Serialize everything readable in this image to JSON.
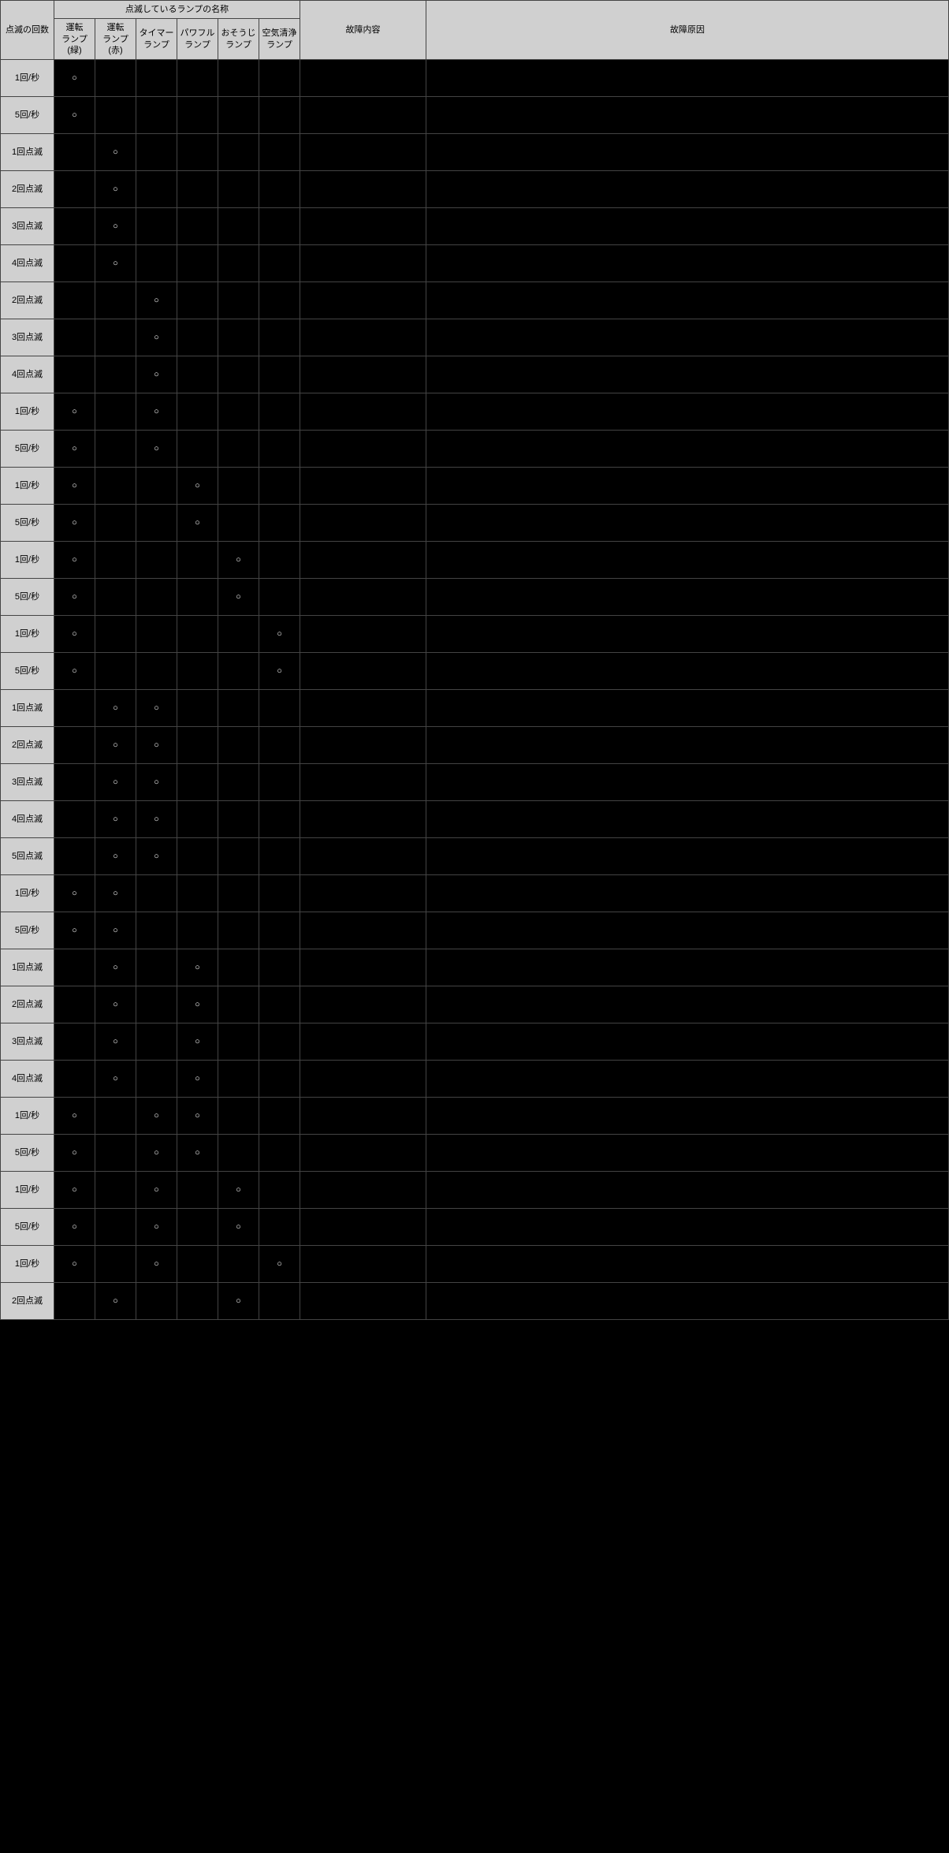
{
  "headers": {
    "count": "点滅の回数",
    "lamp_group": "点滅しているランプの名称",
    "lamps": [
      "運転\nランプ(緑)",
      "運転\nランプ(赤)",
      "タイマー\nランプ",
      "パワフル\nランプ",
      "おそうじ\nランプ",
      "空気清浄\nランプ"
    ],
    "content": "故障内容",
    "cause": "故障原因"
  },
  "rows": [
    {
      "count": "1回/秒",
      "lamps": [
        "○",
        "",
        "",
        "",
        "",
        ""
      ],
      "content": "",
      "cause": ""
    },
    {
      "count": "5回/秒",
      "lamps": [
        "○",
        "",
        "",
        "",
        "",
        ""
      ],
      "content": "",
      "cause": ""
    },
    {
      "count": "1回点滅",
      "lamps": [
        "",
        "○",
        "",
        "",
        "",
        ""
      ],
      "content": "",
      "cause": ""
    },
    {
      "count": "2回点滅",
      "lamps": [
        "",
        "○",
        "",
        "",
        "",
        ""
      ],
      "content": "",
      "cause": ""
    },
    {
      "count": "3回点滅",
      "lamps": [
        "",
        "○",
        "",
        "",
        "",
        ""
      ],
      "content": "",
      "cause": ""
    },
    {
      "count": "4回点滅",
      "lamps": [
        "",
        "○",
        "",
        "",
        "",
        ""
      ],
      "content": "",
      "cause": ""
    },
    {
      "count": "2回点滅",
      "lamps": [
        "",
        "",
        "○",
        "",
        "",
        ""
      ],
      "content": "",
      "cause": ""
    },
    {
      "count": "3回点滅",
      "lamps": [
        "",
        "",
        "○",
        "",
        "",
        ""
      ],
      "content": "",
      "cause": ""
    },
    {
      "count": "4回点滅",
      "lamps": [
        "",
        "",
        "○",
        "",
        "",
        ""
      ],
      "content": "",
      "cause": ""
    },
    {
      "count": "1回/秒",
      "lamps": [
        "○",
        "",
        "○",
        "",
        "",
        ""
      ],
      "content": "",
      "cause": ""
    },
    {
      "count": "5回/秒",
      "lamps": [
        "○",
        "",
        "○",
        "",
        "",
        ""
      ],
      "content": "",
      "cause": ""
    },
    {
      "count": "1回/秒",
      "lamps": [
        "○",
        "",
        "",
        "○",
        "",
        ""
      ],
      "content": "",
      "cause": ""
    },
    {
      "count": "5回/秒",
      "lamps": [
        "○",
        "",
        "",
        "○",
        "",
        ""
      ],
      "content": "",
      "cause": ""
    },
    {
      "count": "1回/秒",
      "lamps": [
        "○",
        "",
        "",
        "",
        "○",
        ""
      ],
      "content": "",
      "cause": ""
    },
    {
      "count": "5回/秒",
      "lamps": [
        "○",
        "",
        "",
        "",
        "○",
        ""
      ],
      "content": "",
      "cause": ""
    },
    {
      "count": "1回/秒",
      "lamps": [
        "○",
        "",
        "",
        "",
        "",
        "○"
      ],
      "content": "",
      "cause": ""
    },
    {
      "count": "5回/秒",
      "lamps": [
        "○",
        "",
        "",
        "",
        "",
        "○"
      ],
      "content": "",
      "cause": ""
    },
    {
      "count": "1回点滅",
      "lamps": [
        "",
        "○",
        "○",
        "",
        "",
        ""
      ],
      "content": "",
      "cause": ""
    },
    {
      "count": "2回点滅",
      "lamps": [
        "",
        "○",
        "○",
        "",
        "",
        ""
      ],
      "content": "",
      "cause": ""
    },
    {
      "count": "3回点滅",
      "lamps": [
        "",
        "○",
        "○",
        "",
        "",
        ""
      ],
      "content": "",
      "cause": ""
    },
    {
      "count": "4回点滅",
      "lamps": [
        "",
        "○",
        "○",
        "",
        "",
        ""
      ],
      "content": "",
      "cause": ""
    },
    {
      "count": "5回点滅",
      "lamps": [
        "",
        "○",
        "○",
        "",
        "",
        ""
      ],
      "content": "",
      "cause": ""
    },
    {
      "count": "1回/秒",
      "lamps": [
        "○",
        "○",
        "",
        "",
        "",
        ""
      ],
      "content": "",
      "cause": ""
    },
    {
      "count": "5回/秒",
      "lamps": [
        "○",
        "○",
        "",
        "",
        "",
        ""
      ],
      "content": "",
      "cause": ""
    },
    {
      "count": "1回点滅",
      "lamps": [
        "",
        "○",
        "",
        "○",
        "",
        ""
      ],
      "content": "",
      "cause": ""
    },
    {
      "count": "2回点滅",
      "lamps": [
        "",
        "○",
        "",
        "○",
        "",
        ""
      ],
      "content": "",
      "cause": ""
    },
    {
      "count": "3回点滅",
      "lamps": [
        "",
        "○",
        "",
        "○",
        "",
        ""
      ],
      "content": "",
      "cause": ""
    },
    {
      "count": "4回点滅",
      "lamps": [
        "",
        "○",
        "",
        "○",
        "",
        ""
      ],
      "content": "",
      "cause": ""
    },
    {
      "count": "1回/秒",
      "lamps": [
        "○",
        "",
        "○",
        "○",
        "",
        ""
      ],
      "content": "",
      "cause": ""
    },
    {
      "count": "5回/秒",
      "lamps": [
        "○",
        "",
        "○",
        "○",
        "",
        ""
      ],
      "content": "",
      "cause": ""
    },
    {
      "count": "1回/秒",
      "lamps": [
        "○",
        "",
        "○",
        "",
        "○",
        ""
      ],
      "content": "",
      "cause": ""
    },
    {
      "count": "5回/秒",
      "lamps": [
        "○",
        "",
        "○",
        "",
        "○",
        ""
      ],
      "content": "",
      "cause": ""
    },
    {
      "count": "1回/秒",
      "lamps": [
        "○",
        "",
        "○",
        "",
        "",
        "○"
      ],
      "content": "",
      "cause": ""
    },
    {
      "count": "2回点滅",
      "lamps": [
        "",
        "○",
        "",
        "",
        "○",
        ""
      ],
      "content": "",
      "cause": ""
    }
  ]
}
